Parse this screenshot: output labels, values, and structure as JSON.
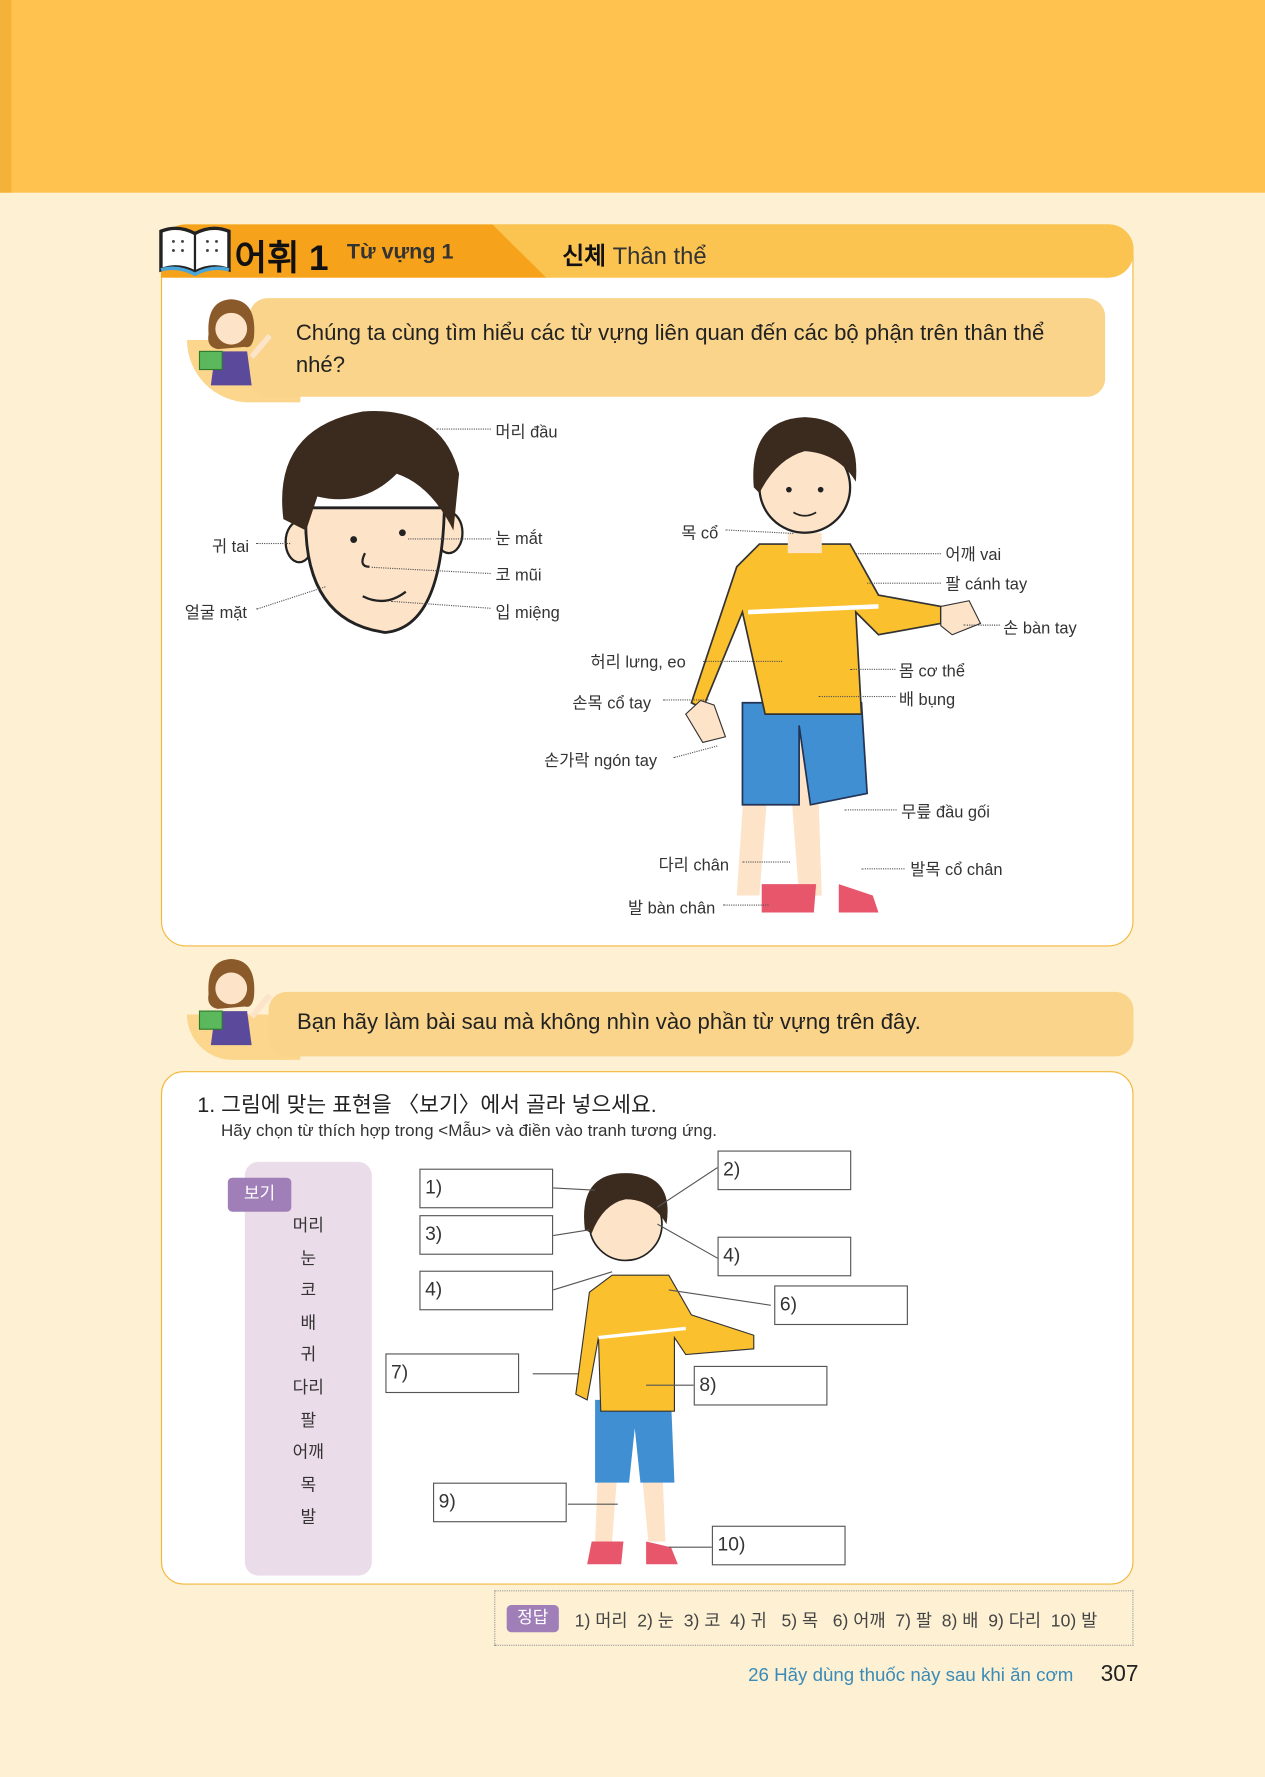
{
  "section": {
    "title_ko": "어휘 1",
    "title_vi": "Từ vựng 1",
    "topic_ko": "신체",
    "topic_vi": "Thân thể"
  },
  "intro": "Chúng ta cùng tìm hiểu các từ vựng liên quan đến các bộ phận trên thân thể nhé?",
  "face_labels": {
    "head": "머리 đầu",
    "eye": "눈 mắt",
    "nose": "코 mũi",
    "mouth": "입 miệng",
    "ear": "귀 tai",
    "face": "얼굴 mặt"
  },
  "body_labels": {
    "neck": "목 cổ",
    "shoulder": "어깨 vai",
    "arm": "팔 cánh tay",
    "hand": "손 bàn tay",
    "waist": "허리 lưng, eo",
    "torso": "몸 cơ thể",
    "wrist": "손목 cổ tay",
    "belly": "배 bụng",
    "finger": "손가락 ngón tay",
    "knee": "무릎 đầu gối",
    "leg": "다리 chân",
    "ankle": "발목 cổ chân",
    "foot": "발 bàn chân"
  },
  "prompt2": "Bạn hãy làm bài sau mà không nhìn vào phần từ vựng trên đây.",
  "exercise": {
    "instruction_ko": "1. 그림에 맞는 표현을 〈보기〉에서 골라 넣으세요.",
    "instruction_vi": "Hãy chọn từ thích hợp trong <Mẫu> và điền vào tranh tương ứng.",
    "bogi_label": "보기",
    "bogi": [
      "머리",
      "눈",
      "코",
      "배",
      "귀",
      "다리",
      "팔",
      "어깨",
      "목",
      "발"
    ],
    "boxes": [
      "1)",
      "2)",
      "3)",
      "4)",
      "4)",
      "6)",
      "7)",
      "8)",
      "9)",
      "10)"
    ]
  },
  "answers": {
    "label": "정답",
    "text": "1) 머리  2) 눈  3) 코  4) 귀   5) 목   6) 어깨  7) 팔  8) 배  9) 다리  10) 발"
  },
  "footer": {
    "chapter": "26 Hãy dùng thuốc này sau khi ăn cơm",
    "page": "307"
  },
  "colors": {
    "orange": "#f7a21b",
    "yellow": "#fbc451",
    "bubble": "#f9d48a",
    "purple": "#a07fb8",
    "footer_text": "#3a8bb8"
  }
}
